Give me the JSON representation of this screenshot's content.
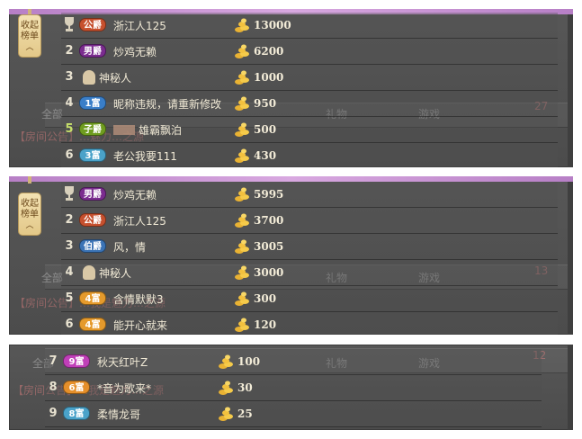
{
  "panels": [
    {
      "collapse_label": "收起榜单",
      "ghost": {
        "left": "全部",
        "c1": "礼物",
        "c2": "游戏",
        "num": "27",
        "bottom": "【房间公告】…魅力…之源"
      },
      "rows": [
        {
          "rank": "1",
          "trophy": true,
          "badge": "公爵",
          "badge_color": "#c6502e",
          "name": "浙江人125",
          "value": "13000"
        },
        {
          "rank": "2",
          "badge": "男爵",
          "badge_color": "#7b2c8f",
          "name": "炒鸡无赖",
          "value": "6200"
        },
        {
          "rank": "3",
          "avatar": true,
          "name": "神秘人",
          "value": "1000"
        },
        {
          "rank": "4",
          "badge": "1富",
          "badge_color": "#3a7ec8",
          "name": "昵称违规，请重新修改",
          "value": "950"
        },
        {
          "rank": "5",
          "badge": "子爵",
          "badge_color": "#6f9c1f",
          "blurred": true,
          "name": "雄霸飘泊",
          "value": "500"
        },
        {
          "rank": "6",
          "badge": "3富",
          "badge_color": "#4aa2c9",
          "name": "老公我要111",
          "value": "430"
        }
      ]
    },
    {
      "collapse_label": "收起榜单",
      "ghost": {
        "left": "全部",
        "c1": "礼物",
        "c2": "游戏",
        "num": "13",
        "bottom": "【房间公告】…我是魅力…之源"
      },
      "rows": [
        {
          "rank": "1",
          "trophy": true,
          "badge": "男爵",
          "badge_color": "#7b2c8f",
          "name": "炒鸡无赖",
          "value": "5995"
        },
        {
          "rank": "2",
          "badge": "公爵",
          "badge_color": "#c6502e",
          "name": "浙江人125",
          "value": "3700"
        },
        {
          "rank": "3",
          "badge": "伯爵",
          "badge_color": "#3b73b5",
          "name": "风，情",
          "value": "3005"
        },
        {
          "rank": "4",
          "avatar": true,
          "name": "神秘人",
          "value": "3000"
        },
        {
          "rank": "5",
          "badge": "4富",
          "badge_color": "#e59a2c",
          "name": "含情默默3",
          "value": "300"
        },
        {
          "rank": "6",
          "badge": "4富",
          "badge_color": "#e59a2c",
          "name": "能开心就来",
          "value": "120"
        }
      ]
    },
    {
      "ghost": {
        "left": "全部",
        "c1": "礼物",
        "c2": "游戏",
        "num": "12",
        "bottom": "【房间公告】…我是魅力…之源"
      },
      "rows": [
        {
          "rank": "7",
          "badge": "9富",
          "badge_color": "#c03fb8",
          "name": "秋天红叶Z",
          "value": "100"
        },
        {
          "rank": "8",
          "badge": "6富",
          "badge_color": "#e58f2a",
          "name": "*音为歌来*",
          "value": "30"
        },
        {
          "rank": "9",
          "badge": "8富",
          "badge_color": "#4aa2c9",
          "name": "柔情龙哥",
          "value": "25"
        }
      ]
    }
  ]
}
